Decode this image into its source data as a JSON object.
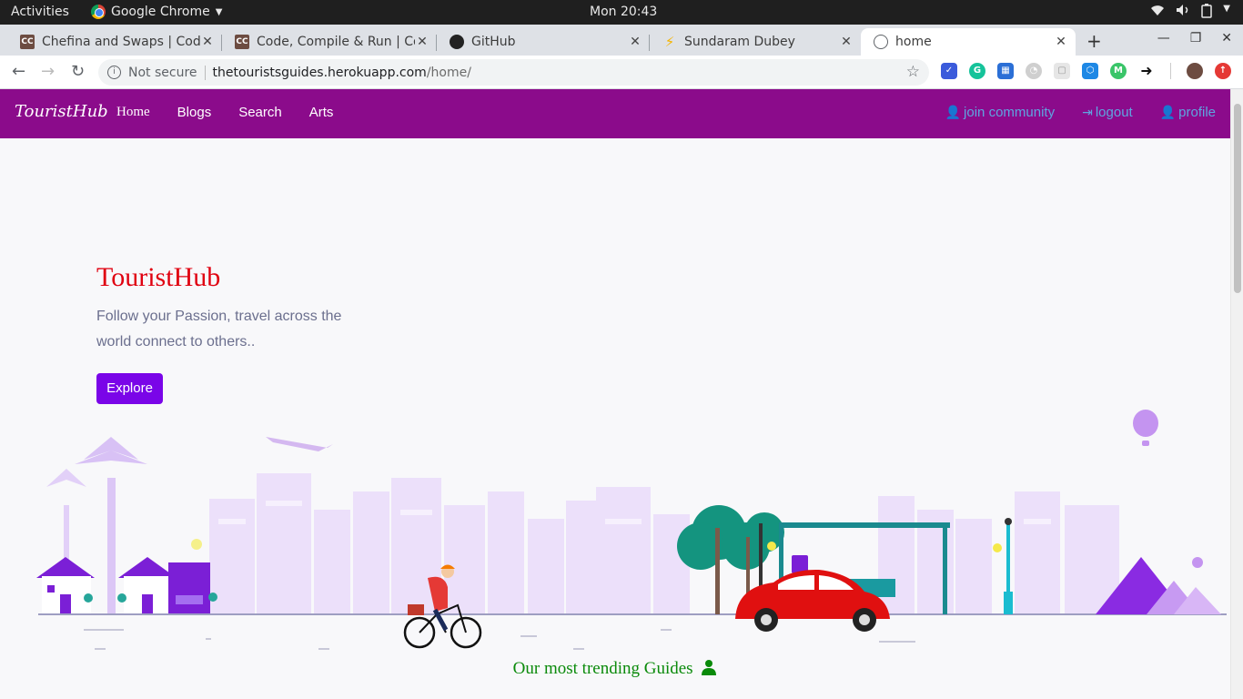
{
  "system": {
    "activities": "Activities",
    "app_name": "Google Chrome",
    "clock": "Mon 20:43"
  },
  "tabs": [
    {
      "title": "Chefina and Swaps | Code",
      "favicon": "codechef-icon"
    },
    {
      "title": "Code, Compile & Run | Co",
      "favicon": "codechef-icon"
    },
    {
      "title": "GitHub",
      "favicon": "github-icon"
    },
    {
      "title": "Sundaram Dubey",
      "favicon": "bolt-icon"
    },
    {
      "title": "home",
      "favicon": "globe-icon",
      "active": true
    }
  ],
  "address_bar": {
    "security": "Not secure",
    "host": "thetouristsguides.herokuapp.com",
    "path": "/home/"
  },
  "site_nav": {
    "brand": "TouristHub",
    "links": [
      "Home",
      "Blogs",
      "Search",
      "Arts"
    ],
    "right_links": [
      "join community",
      "logout",
      "profile"
    ]
  },
  "hero": {
    "title": "TouristHub",
    "subtitle": "Follow your Passion, travel across the world connect to others..",
    "button": "Explore"
  },
  "section": {
    "trending_title": "Our most trending Guides"
  },
  "colors": {
    "navbar": "#8b0b8b",
    "hero_title": "#e00010",
    "button": "#7a05e8",
    "trending": "#0a8a0a",
    "nav_right_links": "#5ea5e0"
  }
}
